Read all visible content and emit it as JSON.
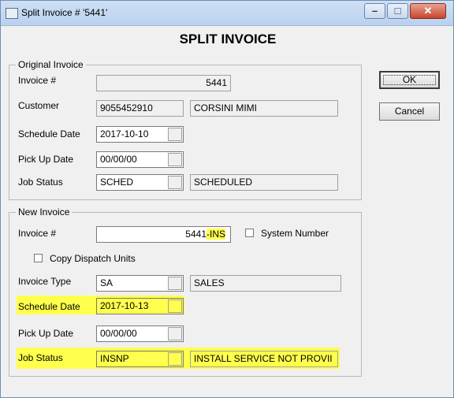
{
  "window": {
    "title": "Split Invoice # '5441'"
  },
  "heading": "SPLIT INVOICE",
  "original": {
    "legend": "Original Invoice",
    "invoice_label": "Invoice #",
    "invoice_value": "5441",
    "customer_label": "Customer",
    "customer_phone": "9055452910",
    "customer_name": "CORSINI MIMI",
    "schedule_label": "Schedule Date",
    "schedule_value": "2017-10-10",
    "pickup_label": "Pick Up Date",
    "pickup_value": "00/00/00",
    "status_label": "Job Status",
    "status_code": "SCHED",
    "status_desc": "SCHEDULED"
  },
  "new_invoice": {
    "legend": "New Invoice",
    "invoice_label": "Invoice #",
    "invoice_value_main": "5441",
    "invoice_value_suffix": "-INS",
    "system_number_label": "System Number",
    "copy_dispatch_label": "Copy Dispatch Units",
    "type_label": "Invoice Type",
    "type_code": "SA",
    "type_desc": "SALES",
    "schedule_label": "Schedule Date",
    "schedule_value": "2017-10-13",
    "pickup_label": "Pick Up Date",
    "pickup_value": "00/00/00",
    "status_label": "Job Status",
    "status_code": "INSNP",
    "status_desc": "INSTALL SERVICE NOT PROVII"
  },
  "buttons": {
    "ok": "OK",
    "cancel": "Cancel"
  },
  "colors": {
    "highlight": "#ffff4d"
  }
}
